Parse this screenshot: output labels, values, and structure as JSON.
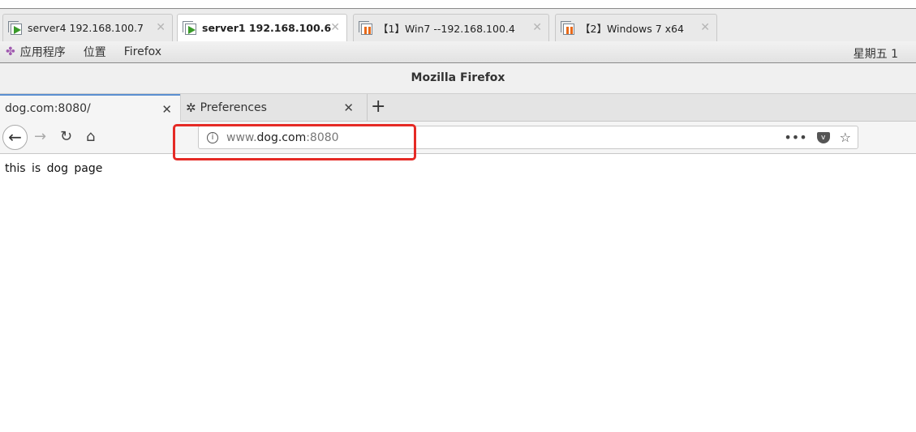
{
  "vm_tabs": [
    {
      "label": "server4 192.168.100.7",
      "state": "running",
      "active": false
    },
    {
      "label": "server1 192.168.100.6",
      "state": "running",
      "active": true
    },
    {
      "label": "【1】Win7 --192.168.100.4",
      "state": "paused",
      "active": false
    },
    {
      "label": "【2】Windows 7 x64",
      "state": "paused",
      "active": false
    }
  ],
  "gnome_bar": {
    "applications": "应用程序",
    "places": "位置",
    "firefox": "Firefox",
    "clock": "星期五 1"
  },
  "window_title": "Mozilla Firefox",
  "browser_tabs": [
    {
      "label": "dog.com:8080/",
      "active": true
    },
    {
      "label": "Preferences",
      "icon": "gear-icon",
      "active": false
    }
  ],
  "url": {
    "prefix": "www.",
    "domain": "dog.com",
    "suffix": ":8080"
  },
  "page": {
    "text": "this is dog page"
  },
  "colors": {
    "highlight": "#e52a25",
    "active_tab_accent": "#5b8fd1"
  }
}
